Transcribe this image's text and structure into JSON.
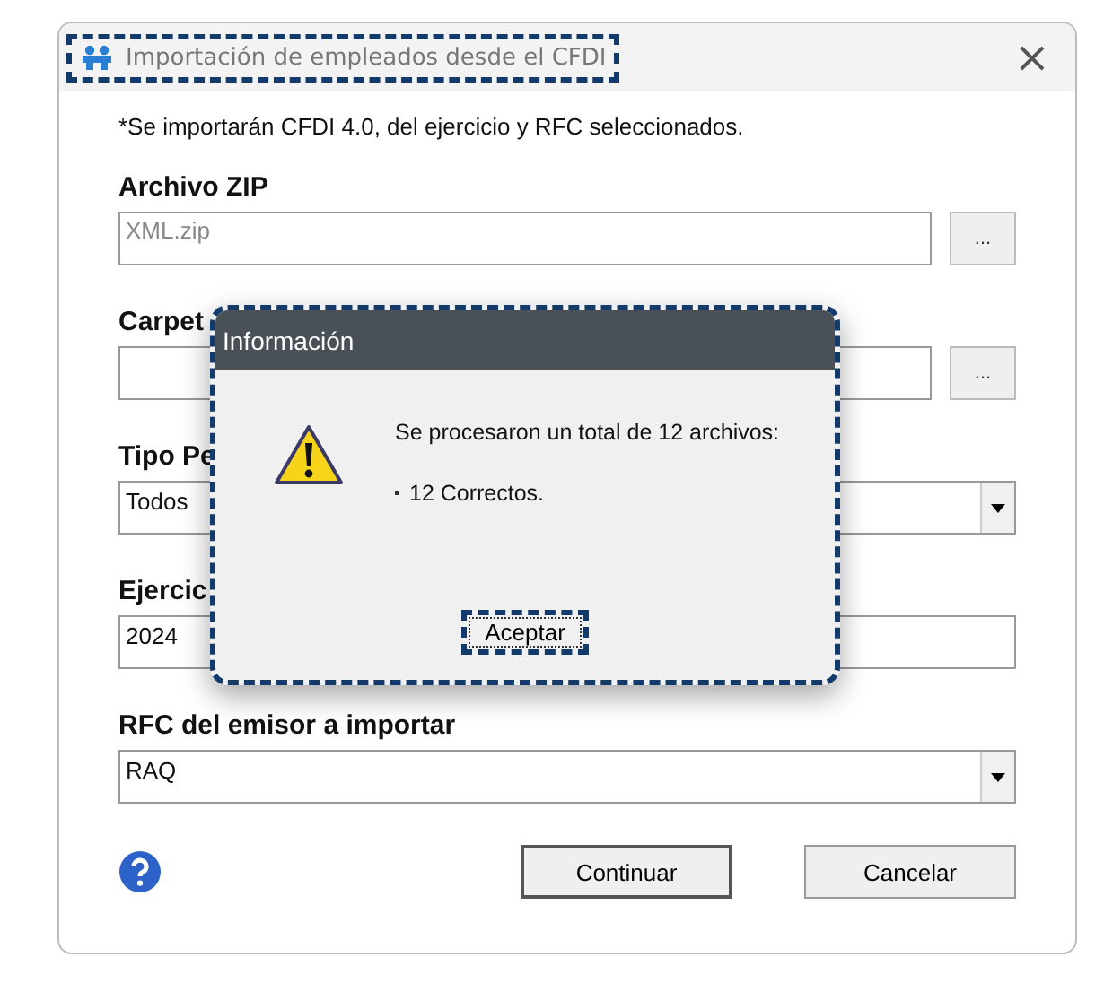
{
  "window": {
    "title": "Importación de empleados desde el CFDI",
    "close": "×"
  },
  "note": "*Se importarán CFDI 4.0, del ejercicio y RFC seleccionados.",
  "fields": [
    {
      "kind": "browse",
      "label": "Archivo ZIP",
      "placeholder": "XML.zip",
      "button": "..."
    },
    {
      "kind": "browse",
      "label": "Carpet",
      "button": "..."
    },
    {
      "kind": "combo",
      "label": "Tipo Pe",
      "value": "Todos"
    },
    {
      "kind": "text",
      "label": "Ejercic",
      "value": "2024"
    },
    {
      "kind": "combo",
      "label": "RFC del emisor a importar",
      "value": "RAQ"
    }
  ],
  "buttons": [
    {
      "label": "Continuar",
      "default": true
    },
    {
      "label": "Cancelar",
      "default": false
    }
  ],
  "dialog": {
    "title": "Información",
    "message": "Se procesaron un total de 12 archivos:",
    "items": [
      "12 Correctos."
    ],
    "button": "Aceptar"
  }
}
